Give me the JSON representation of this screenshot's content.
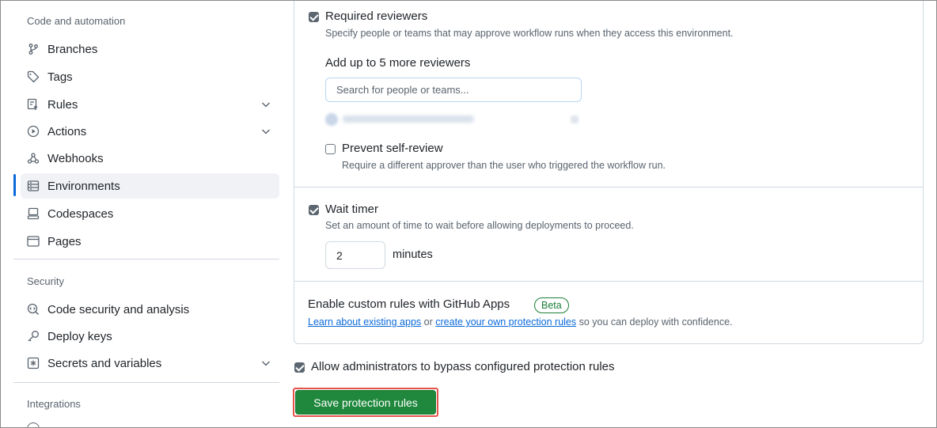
{
  "sidebar": {
    "sections": [
      {
        "title": "Code and automation",
        "items": [
          {
            "label": "Branches",
            "icon": "branch-icon"
          },
          {
            "label": "Tags",
            "icon": "tag-icon"
          },
          {
            "label": "Rules",
            "icon": "rules-icon",
            "expandable": true
          },
          {
            "label": "Actions",
            "icon": "play-icon",
            "expandable": true
          },
          {
            "label": "Webhooks",
            "icon": "webhook-icon"
          },
          {
            "label": "Environments",
            "icon": "server-icon",
            "active": true
          },
          {
            "label": "Codespaces",
            "icon": "codespaces-icon"
          },
          {
            "label": "Pages",
            "icon": "browser-icon"
          }
        ]
      },
      {
        "title": "Security",
        "items": [
          {
            "label": "Code security and analysis",
            "icon": "codescan-icon"
          },
          {
            "label": "Deploy keys",
            "icon": "key-icon"
          },
          {
            "label": "Secrets and variables",
            "icon": "asterisk-icon",
            "expandable": true
          }
        ]
      },
      {
        "title": "Integrations",
        "items": []
      }
    ]
  },
  "main": {
    "required_reviewers": {
      "checked": true,
      "label": "Required reviewers",
      "description": "Specify people or teams that may approve workflow runs when they access this environment.",
      "add_heading": "Add up to 5 more reviewers",
      "search_placeholder": "Search for people or teams..."
    },
    "prevent_self_review": {
      "checked": false,
      "label": "Prevent self-review",
      "description": "Require a different approver than the user who triggered the workflow run."
    },
    "wait_timer": {
      "checked": true,
      "label": "Wait timer",
      "description": "Set an amount of time to wait before allowing deployments to proceed.",
      "value": "2",
      "unit": "minutes"
    },
    "custom_rules": {
      "title": "Enable custom rules with GitHub Apps",
      "badge": "Beta",
      "link1": "Learn about existing apps",
      "or_text": "or",
      "link2": "create your own protection rules",
      "suffix": "so you can deploy with confidence."
    },
    "bypass": {
      "checked": true,
      "label": "Allow administrators to bypass configured protection rules"
    },
    "save_button": "Save protection rules"
  },
  "colors": {
    "accent": "#0969da",
    "save_green": "#1f883d",
    "beta_green": "#1a7f37",
    "highlight_red": "#e5534b"
  }
}
